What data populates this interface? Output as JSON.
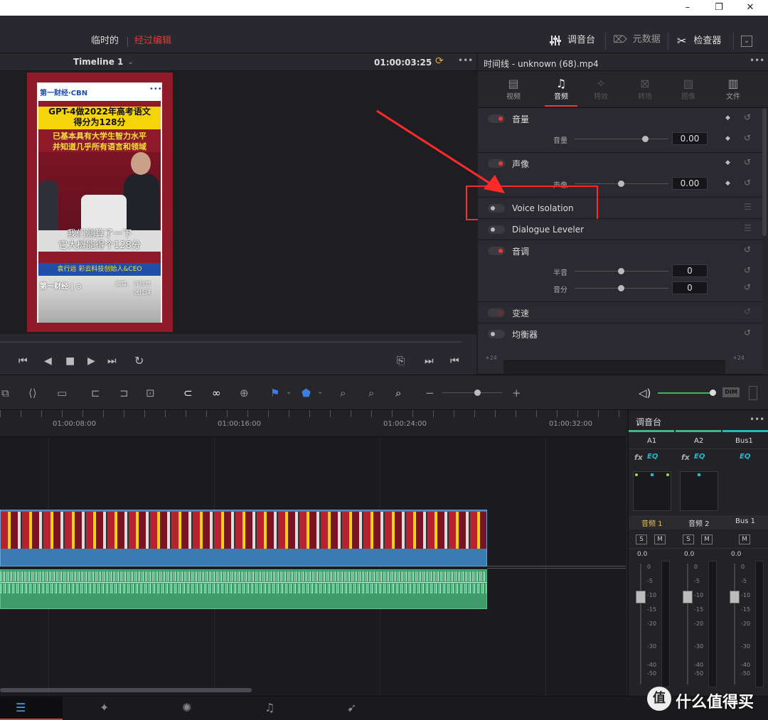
{
  "window": {
    "min": "–",
    "max": "❐",
    "close": "✕"
  },
  "header": {
    "project_name": "临时的",
    "project_status": "经过编辑",
    "mixer_label": "调音台",
    "metadata_label": "元数据",
    "inspector_label": "检查器"
  },
  "viewer": {
    "timeline_name": "Timeline 1",
    "timecode": "01:00:03:25",
    "more": "•••"
  },
  "video": {
    "title_line1": "GPT-4做2022年高考语文",
    "title_line2": "得分为128分",
    "sub_line1": "已基本具有大学生智力水平",
    "sub_line2": "并知道几乎所有语言和领域",
    "caption_line1": "我们测算了一下",
    "caption_line2": "它大概能得个128分",
    "speaker": "袁行远  彩云科技创始人&CEO",
    "editor_label": "编辑:",
    "editor1": "许欣然",
    "editor2": "张佳琪"
  },
  "inspector": {
    "title": "时间线 - unknown (68).mp4",
    "tabs": [
      "视频",
      "音频",
      "特效",
      "转场",
      "图像",
      "文件"
    ],
    "active_tab": 1,
    "volume": {
      "label": "音量",
      "param": "音量",
      "value": "0.00",
      "level": 0.75
    },
    "pan": {
      "label": "声像",
      "param": "声像",
      "value": "0.00",
      "level": 0.5
    },
    "voice_isolation": {
      "label": "Voice Isolation"
    },
    "dialogue_leveler": {
      "label": "Dialogue Leveler"
    },
    "pitch": {
      "label": "音调",
      "semitones_label": "半音",
      "semitones_value": "0",
      "cents_label": "音分",
      "cents_value": "0"
    },
    "speed": {
      "label": "变速"
    },
    "eq": {
      "label": "均衡器",
      "left_db": "+24",
      "right_db": "+24"
    }
  },
  "timeline": {
    "timecodes": [
      "01:00:08:00",
      "01:00:16:00",
      "01:00:24:00",
      "01:00:32:00"
    ]
  },
  "mixer": {
    "title": "调音台",
    "channels": [
      "A1",
      "A2",
      "Bus1"
    ],
    "fx": "fx",
    "eq": "EQ",
    "track_names": [
      "音频 1",
      "音频 2",
      "Bus 1"
    ],
    "solo": "S",
    "mute": "M",
    "fader_value": "0.0",
    "scale": [
      "0",
      "-5",
      "-10",
      "-15",
      "-20",
      "-30",
      "-40",
      "-50"
    ]
  },
  "toolbar": {
    "dim": "DIM"
  },
  "watermark": "什么值得买",
  "colors": {
    "accent_red": "#e53935",
    "annotation_red": "#ff2a2a",
    "audio_green": "#3f9b6a",
    "clip_blue": "#3c7ab3",
    "mixer_teal": "#23b9c9"
  }
}
